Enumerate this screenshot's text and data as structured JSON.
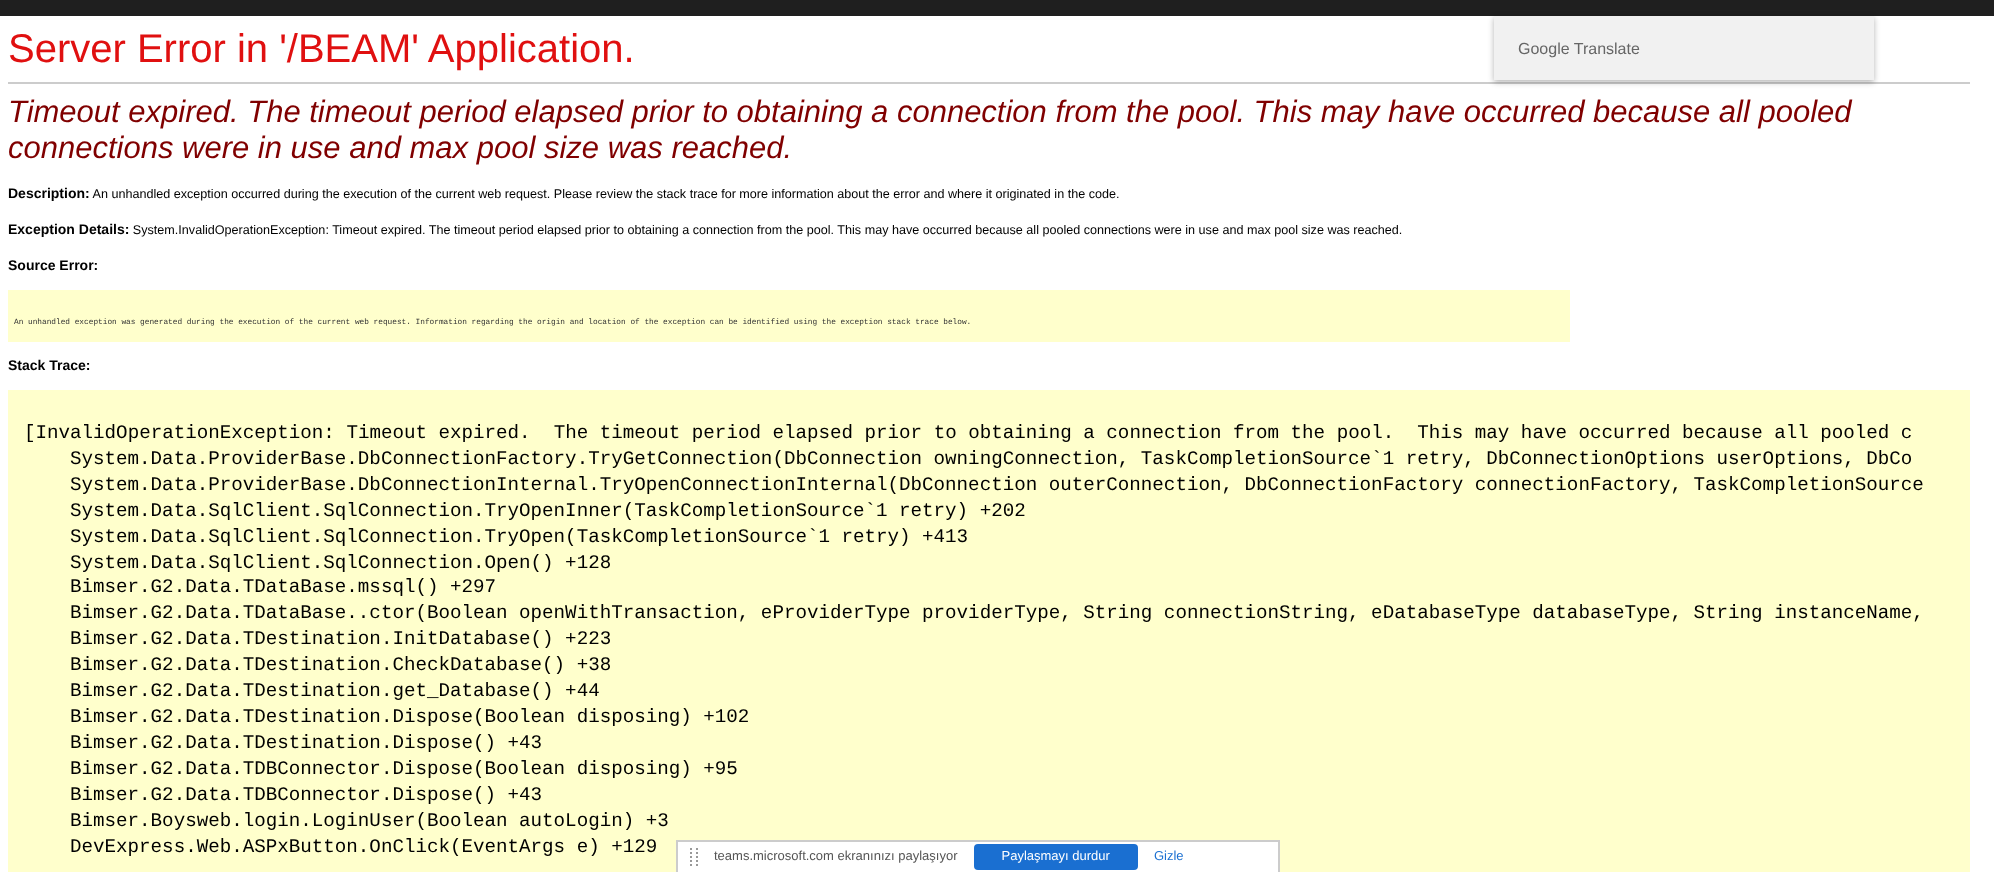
{
  "title": "Server Error in '/BEAM' Application.",
  "translate_popup": {
    "label": "Google Translate"
  },
  "error_message": "Timeout expired.  The timeout period elapsed prior to obtaining a connection from the pool.  This may have occurred because all pooled connections were in use and max pool size was reached.",
  "description": {
    "label": "Description:",
    "text": "An unhandled exception occurred during the execution of the current web request. Please review the stack trace for more information about the error and where it originated in the code."
  },
  "exception_details": {
    "label": "Exception Details:",
    "text": "System.InvalidOperationException: Timeout expired.  The timeout period elapsed prior to obtaining a connection from the pool.  This may have occurred because all pooled connections were in use and max pool size was reached."
  },
  "source_error": {
    "label": "Source Error:",
    "text": "An unhandled exception was generated during the execution of the current web request. Information regarding the origin and location of the exception can be identified using the exception stack trace below."
  },
  "stack_trace": {
    "label": "Stack Trace:",
    "lines": [
      {
        "kind": "exception",
        "text": "[InvalidOperationException: Timeout expired.  The timeout period elapsed prior to obtaining a connection from the pool.  This may have occurred because all pooled c"
      },
      {
        "kind": "frame",
        "text": "System.Data.ProviderBase.DbConnectionFactory.TryGetConnection(DbConnection owningConnection, TaskCompletionSource`1 retry, DbConnectionOptions userOptions, DbCo"
      },
      {
        "kind": "frame",
        "text": "System.Data.ProviderBase.DbConnectionInternal.TryOpenConnectionInternal(DbConnection outerConnection, DbConnectionFactory connectionFactory, TaskCompletionSource"
      },
      {
        "kind": "frame",
        "text": "System.Data.SqlClient.SqlConnection.TryOpenInner(TaskCompletionSource`1 retry) +202"
      },
      {
        "kind": "frame",
        "text": "System.Data.SqlClient.SqlConnection.TryOpen(TaskCompletionSource`1 retry) +413"
      },
      {
        "kind": "frame",
        "text": "System.Data.SqlClient.SqlConnection.Open() +128"
      },
      {
        "kind": "frame",
        "text": "Bimser.G2.Data.TDataBase.mssql() +297"
      },
      {
        "kind": "frame",
        "text": "Bimser.G2.Data.TDataBase..ctor(Boolean openWithTransaction, eProviderType providerType, String connectionString, eDatabaseType databaseType, String instanceName,"
      },
      {
        "kind": "frame",
        "text": "Bimser.G2.Data.TDestination.InitDatabase() +223"
      },
      {
        "kind": "frame",
        "text": "Bimser.G2.Data.TDestination.CheckDatabase() +38"
      },
      {
        "kind": "frame",
        "text": "Bimser.G2.Data.TDestination.get_Database() +44"
      },
      {
        "kind": "frame",
        "text": "Bimser.G2.Data.TDestination.Dispose(Boolean disposing) +102"
      },
      {
        "kind": "frame",
        "text": "Bimser.G2.Data.TDestination.Dispose() +43"
      },
      {
        "kind": "frame",
        "text": "Bimser.G2.Data.TDBConnector.Dispose(Boolean disposing) +95"
      },
      {
        "kind": "frame",
        "text": "Bimser.G2.Data.TDBConnector.Dispose() +43"
      },
      {
        "kind": "frame",
        "text": "Bimser.Boysweb.login.LoginUser(Boolean autoLogin) +3"
      },
      {
        "kind": "frame",
        "text": "DevExpress.Web.ASPxButton.OnClick(EventArgs e) +129"
      }
    ]
  },
  "share_bar": {
    "text": "teams.microsoft.com ekranınızı paylaşıyor",
    "stop_button": "Paylaşmayı durdur",
    "hide_button": "Gizle"
  }
}
